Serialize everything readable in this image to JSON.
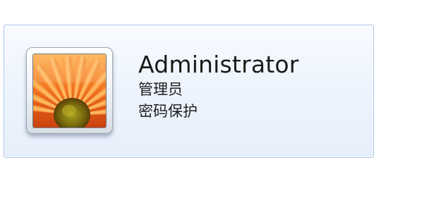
{
  "user_card": {
    "name": "Administrator",
    "role": "管理员",
    "status": "密码保护",
    "avatar_icon": "orange-flower-avatar-icon"
  },
  "colors": {
    "card_border": "#a9c3e6",
    "card_background": "#eef4fd",
    "text": "#1a1a1a"
  }
}
